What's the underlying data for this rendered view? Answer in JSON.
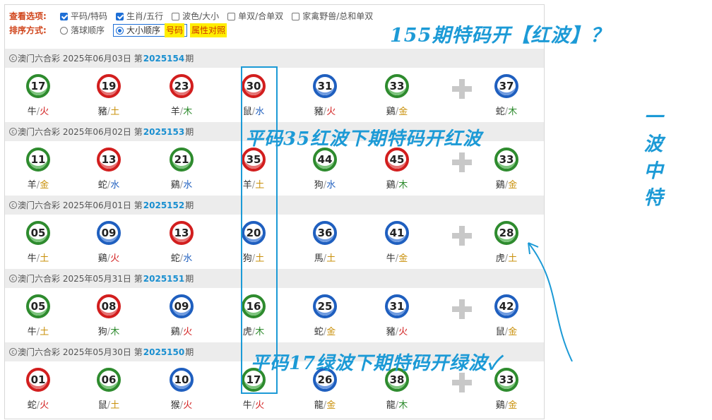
{
  "options": {
    "view_label": "查看选项:",
    "view_opts": [
      {
        "label": "平码/特码",
        "checked": true
      },
      {
        "label": "生肖/五行",
        "checked": true
      },
      {
        "label": "波色/大小",
        "checked": false
      },
      {
        "label": "单双/合单双",
        "checked": false
      },
      {
        "label": "家禽野兽/总和单双",
        "checked": false
      }
    ],
    "sort_label": "排序方式:",
    "sort_opts": [
      {
        "label": "落球顺序",
        "selected": false
      },
      {
        "label": "大小顺序",
        "selected": true
      }
    ],
    "tag_prefix": "号码",
    "tag_mid": "属",
    "tag_suffix": "性对照"
  },
  "draws": [
    {
      "lottery": "澳门六合彩",
      "date": "2025年06月03日",
      "issue_prefix": "第",
      "issue": "2025154",
      "issue_suffix": "期",
      "balls": [
        {
          "num": "17",
          "color": "green",
          "zodiac": "牛",
          "element": "火",
          "el_color": "red"
        },
        {
          "num": "19",
          "color": "red",
          "zodiac": "豬",
          "element": "土",
          "el_color": "gold"
        },
        {
          "num": "23",
          "color": "red",
          "zodiac": "羊",
          "element": "木",
          "el_color": "green"
        },
        {
          "num": "30",
          "color": "red",
          "zodiac": "鼠",
          "element": "水",
          "el_color": "blue"
        },
        {
          "num": "31",
          "color": "blue",
          "zodiac": "豬",
          "element": "火",
          "el_color": "red"
        },
        {
          "num": "33",
          "color": "green",
          "zodiac": "鷄",
          "element": "金",
          "el_color": "gold"
        },
        {
          "num": "37",
          "color": "blue",
          "zodiac": "蛇",
          "element": "木",
          "el_color": "green"
        }
      ]
    },
    {
      "lottery": "澳门六合彩",
      "date": "2025年06月02日",
      "issue_prefix": "第",
      "issue": "2025153",
      "issue_suffix": "期",
      "balls": [
        {
          "num": "11",
          "color": "green",
          "zodiac": "羊",
          "element": "金",
          "el_color": "gold"
        },
        {
          "num": "13",
          "color": "red",
          "zodiac": "蛇",
          "element": "水",
          "el_color": "blue"
        },
        {
          "num": "21",
          "color": "green",
          "zodiac": "鷄",
          "element": "水",
          "el_color": "blue"
        },
        {
          "num": "35",
          "color": "red",
          "zodiac": "羊",
          "element": "土",
          "el_color": "gold"
        },
        {
          "num": "44",
          "color": "green",
          "zodiac": "狗",
          "element": "水",
          "el_color": "blue"
        },
        {
          "num": "45",
          "color": "red",
          "zodiac": "鷄",
          "element": "木",
          "el_color": "green"
        },
        {
          "num": "33",
          "color": "green",
          "zodiac": "鷄",
          "element": "金",
          "el_color": "gold"
        }
      ]
    },
    {
      "lottery": "澳门六合彩",
      "date": "2025年06月01日",
      "issue_prefix": "第",
      "issue": "2025152",
      "issue_suffix": "期",
      "balls": [
        {
          "num": "05",
          "color": "green",
          "zodiac": "牛",
          "element": "土",
          "el_color": "gold"
        },
        {
          "num": "09",
          "color": "blue",
          "zodiac": "鷄",
          "element": "火",
          "el_color": "red"
        },
        {
          "num": "13",
          "color": "red",
          "zodiac": "蛇",
          "element": "水",
          "el_color": "blue"
        },
        {
          "num": "20",
          "color": "blue",
          "zodiac": "狗",
          "element": "土",
          "el_color": "gold"
        },
        {
          "num": "36",
          "color": "blue",
          "zodiac": "馬",
          "element": "土",
          "el_color": "gold"
        },
        {
          "num": "41",
          "color": "blue",
          "zodiac": "牛",
          "element": "金",
          "el_color": "gold"
        },
        {
          "num": "28",
          "color": "green",
          "zodiac": "虎",
          "element": "土",
          "el_color": "gold"
        }
      ]
    },
    {
      "lottery": "澳门六合彩",
      "date": "2025年05月31日",
      "issue_prefix": "第",
      "issue": "2025151",
      "issue_suffix": "期",
      "balls": [
        {
          "num": "05",
          "color": "green",
          "zodiac": "牛",
          "element": "土",
          "el_color": "gold"
        },
        {
          "num": "08",
          "color": "red",
          "zodiac": "狗",
          "element": "木",
          "el_color": "green"
        },
        {
          "num": "09",
          "color": "blue",
          "zodiac": "鷄",
          "element": "火",
          "el_color": "red"
        },
        {
          "num": "16",
          "color": "green",
          "zodiac": "虎",
          "element": "木",
          "el_color": "green"
        },
        {
          "num": "25",
          "color": "blue",
          "zodiac": "蛇",
          "element": "金",
          "el_color": "gold"
        },
        {
          "num": "31",
          "color": "blue",
          "zodiac": "豬",
          "element": "火",
          "el_color": "red"
        },
        {
          "num": "42",
          "color": "blue",
          "zodiac": "鼠",
          "element": "金",
          "el_color": "gold"
        }
      ]
    },
    {
      "lottery": "澳门六合彩",
      "date": "2025年05月30日",
      "issue_prefix": "第",
      "issue": "2025150",
      "issue_suffix": "期",
      "balls": [
        {
          "num": "01",
          "color": "red",
          "zodiac": "蛇",
          "element": "火",
          "el_color": "red"
        },
        {
          "num": "06",
          "color": "green",
          "zodiac": "鼠",
          "element": "土",
          "el_color": "gold"
        },
        {
          "num": "10",
          "color": "blue",
          "zodiac": "猴",
          "element": "火",
          "el_color": "red"
        },
        {
          "num": "17",
          "color": "green",
          "zodiac": "牛",
          "element": "火",
          "el_color": "red"
        },
        {
          "num": "26",
          "color": "blue",
          "zodiac": "龍",
          "element": "金",
          "el_color": "gold"
        },
        {
          "num": "38",
          "color": "green",
          "zodiac": "龍",
          "element": "木",
          "el_color": "green"
        },
        {
          "num": "33",
          "color": "green",
          "zodiac": "鷄",
          "element": "金",
          "el_color": "gold"
        }
      ]
    }
  ],
  "zodiac_separator": "/",
  "copyright_mark": "c",
  "annotations": {
    "top": "155期特码开【红波】？",
    "mid": "平码35红波下期特码开红波",
    "bottom": "平码17绿波下期特码开绿波✓",
    "vertical": [
      "一",
      "波",
      "中",
      "特"
    ]
  },
  "colors": {
    "red_ball": "#d21e1e",
    "blue_ball": "#1f5fbf",
    "green_ball": "#2e8b2e",
    "annotation": "#1c9ad6",
    "issue": "#1a8fd0",
    "header_bg": "#ececec"
  }
}
